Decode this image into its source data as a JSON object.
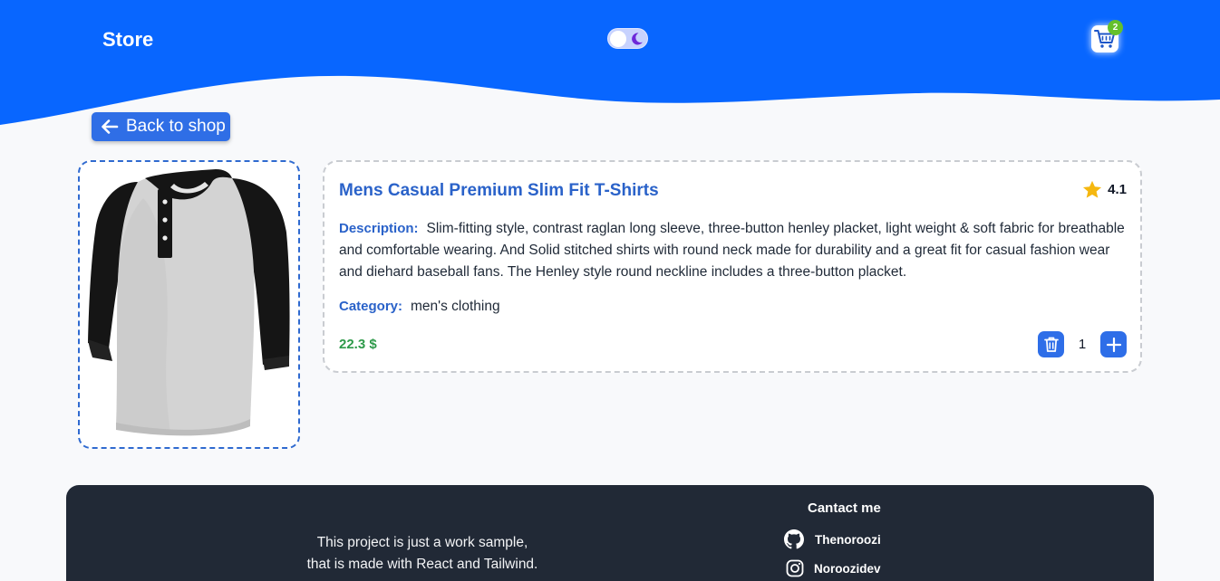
{
  "header": {
    "brand": "Store",
    "cart_count": "2",
    "colors": {
      "header_bg": "#0866ff",
      "accent": "#2f6ee6",
      "badge": "#65c02b"
    },
    "icons": {
      "theme": "moon-icon",
      "cart": "cart-icon"
    }
  },
  "nav": {
    "back_label": "Back to shop",
    "back_icon": "arrow-left-icon"
  },
  "product": {
    "title": "Mens Casual Premium Slim Fit T-Shirts",
    "rating": "4.1",
    "description_label": "Description:",
    "description": "Slim-fitting style, contrast raglan long sleeve, three-button henley placket, light weight & soft fabric for breathable and comfortable wearing. And Solid stitched shirts with round neck made for durability and a great fit for casual fashion wear and diehard baseball fans. The Henley style round neckline includes a three-button placket.",
    "category_label": "Category:",
    "category": "men's clothing",
    "price": "22.3 $",
    "quantity": "1"
  },
  "footer": {
    "note_line1": "This project is just a work sample,",
    "note_line2": "that is made with React and Tailwind.",
    "contact_title": "Cantact me",
    "github": "Thenoroozi",
    "instagram": "Noroozidev"
  }
}
